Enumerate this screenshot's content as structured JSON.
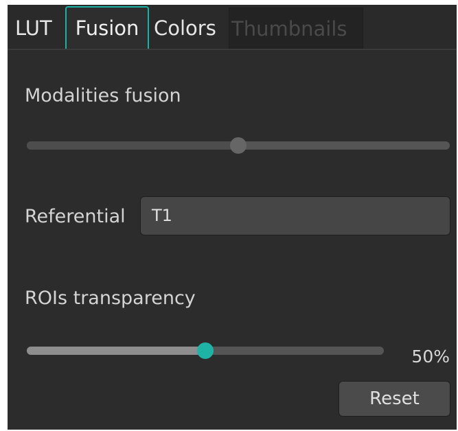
{
  "tabs": [
    {
      "label": "LUT",
      "active": false,
      "enabled": true
    },
    {
      "label": "Fusion",
      "active": true,
      "enabled": true
    },
    {
      "label": "Colors",
      "active": false,
      "enabled": true
    },
    {
      "label": "Thumbnails",
      "active": false,
      "enabled": false
    }
  ],
  "fusion": {
    "label": "Modalities fusion",
    "value_fraction": 0.5
  },
  "referential": {
    "label": "Referential",
    "value": "T1"
  },
  "rois": {
    "label": "ROIs transparency",
    "value_fraction": 0.5,
    "percent_text": "50%",
    "reset_label": "Reset"
  },
  "colors": {
    "accent": "#1fb3a6",
    "panel_bg": "#2c2c2c",
    "text": "#d4d4d4"
  }
}
